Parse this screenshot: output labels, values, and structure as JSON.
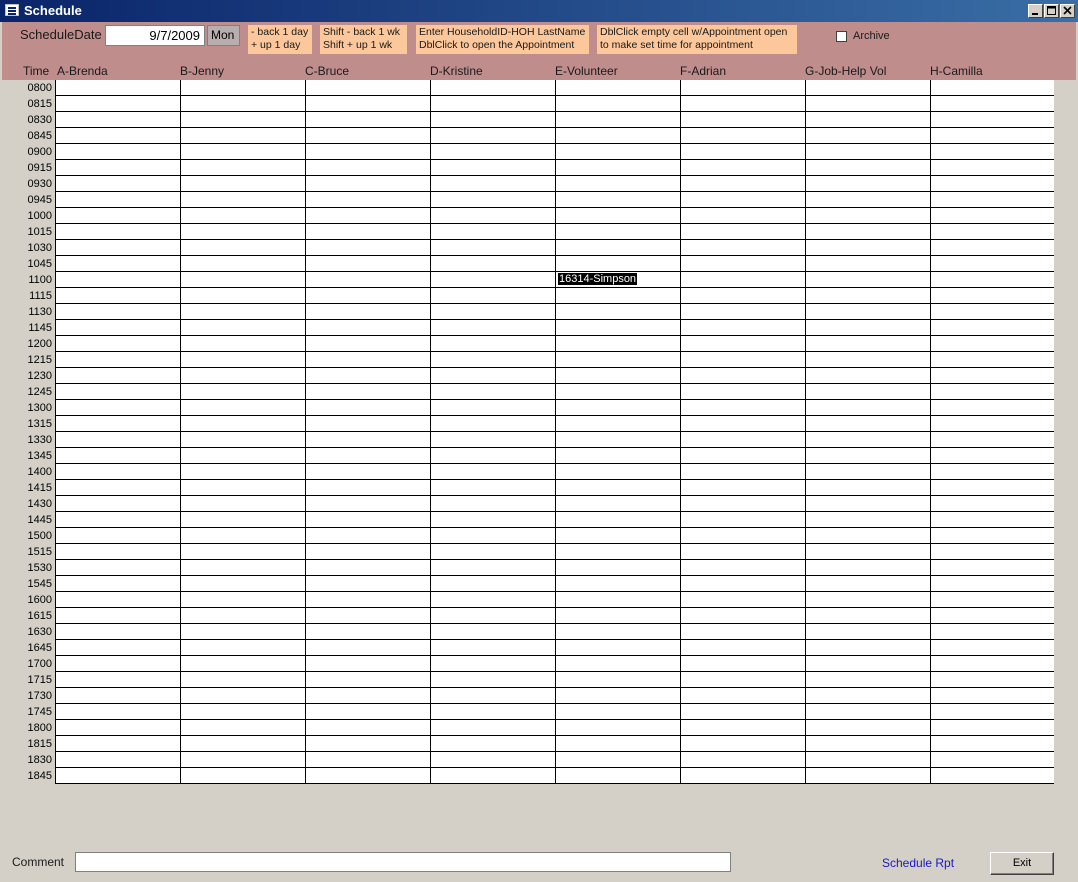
{
  "window": {
    "title": "Schedule",
    "controls": [
      "_",
      "□",
      "x"
    ]
  },
  "header": {
    "schedule_date_label": "ScheduleDate",
    "schedule_date_value": "9/7/2009",
    "day_of_week": "Mon",
    "hints": [
      {
        "line1": "- back 1 day",
        "line2": "+ up 1 day"
      },
      {
        "line1": "Shift - back 1 wk",
        "line2": "Shift + up 1 wk"
      },
      {
        "line1": "Enter HouseholdID-HOH LastName",
        "line2": "DblClick to open the Appointment"
      },
      {
        "line1": "DblClick empty cell w/Appointment open",
        "line2": "to make set time for appointment"
      }
    ],
    "archive_label": "Archive",
    "archive_checked": false
  },
  "columns": [
    "Time",
    "A-Brenda",
    "B-Jenny",
    "C-Bruce",
    "D-Kristine",
    "E-Volunteer",
    "F-Adrian",
    "G-Job-Help Vol",
    "H-Camilla"
  ],
  "times": [
    "0800",
    "0815",
    "0830",
    "0845",
    "0900",
    "0915",
    "0930",
    "0945",
    "1000",
    "1015",
    "1030",
    "1045",
    "1100",
    "1115",
    "1130",
    "1145",
    "1200",
    "1215",
    "1230",
    "1245",
    "1300",
    "1315",
    "1330",
    "1345",
    "1400",
    "1415",
    "1430",
    "1445",
    "1500",
    "1515",
    "1530",
    "1545",
    "1600",
    "1615",
    "1630",
    "1645",
    "1700",
    "1715",
    "1730",
    "1745",
    "1800",
    "1815",
    "1830",
    "1845"
  ],
  "appointments": [
    {
      "time": "1100",
      "column": "E-Volunteer",
      "text": "16314-Simpson",
      "selected": true
    }
  ],
  "footer": {
    "comment_label": "Comment",
    "comment_value": "",
    "report_link": "Schedule Rpt",
    "exit_label": "Exit"
  }
}
